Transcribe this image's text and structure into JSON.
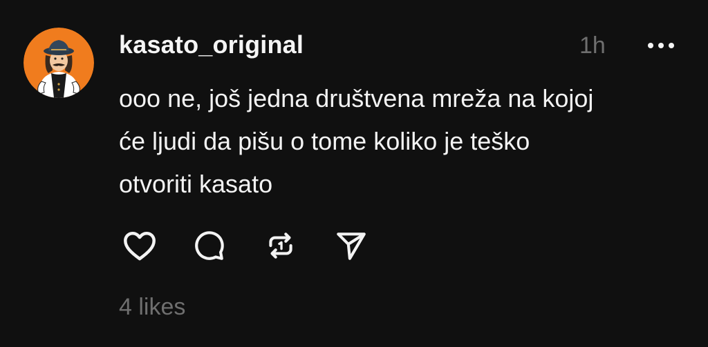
{
  "post": {
    "username": "kasato_original",
    "time": "1h",
    "text_lines": [
      "ooo ne, još jedna društvena mreža na kojoj",
      "će ljudi da pišu o tome koliko je teško",
      "otvoriti kasato"
    ],
    "likes": "4 likes"
  },
  "icons": {
    "avatar": "mascot-avatar",
    "more": "more-dots-icon",
    "like": "heart-icon",
    "reply": "comment-icon",
    "repost": "repost-icon",
    "share": "send-icon"
  },
  "colors": {
    "background": "#101010",
    "text": "#f3f3f3",
    "muted": "#6f6f6f",
    "avatar_bg": "#f07c1e"
  }
}
